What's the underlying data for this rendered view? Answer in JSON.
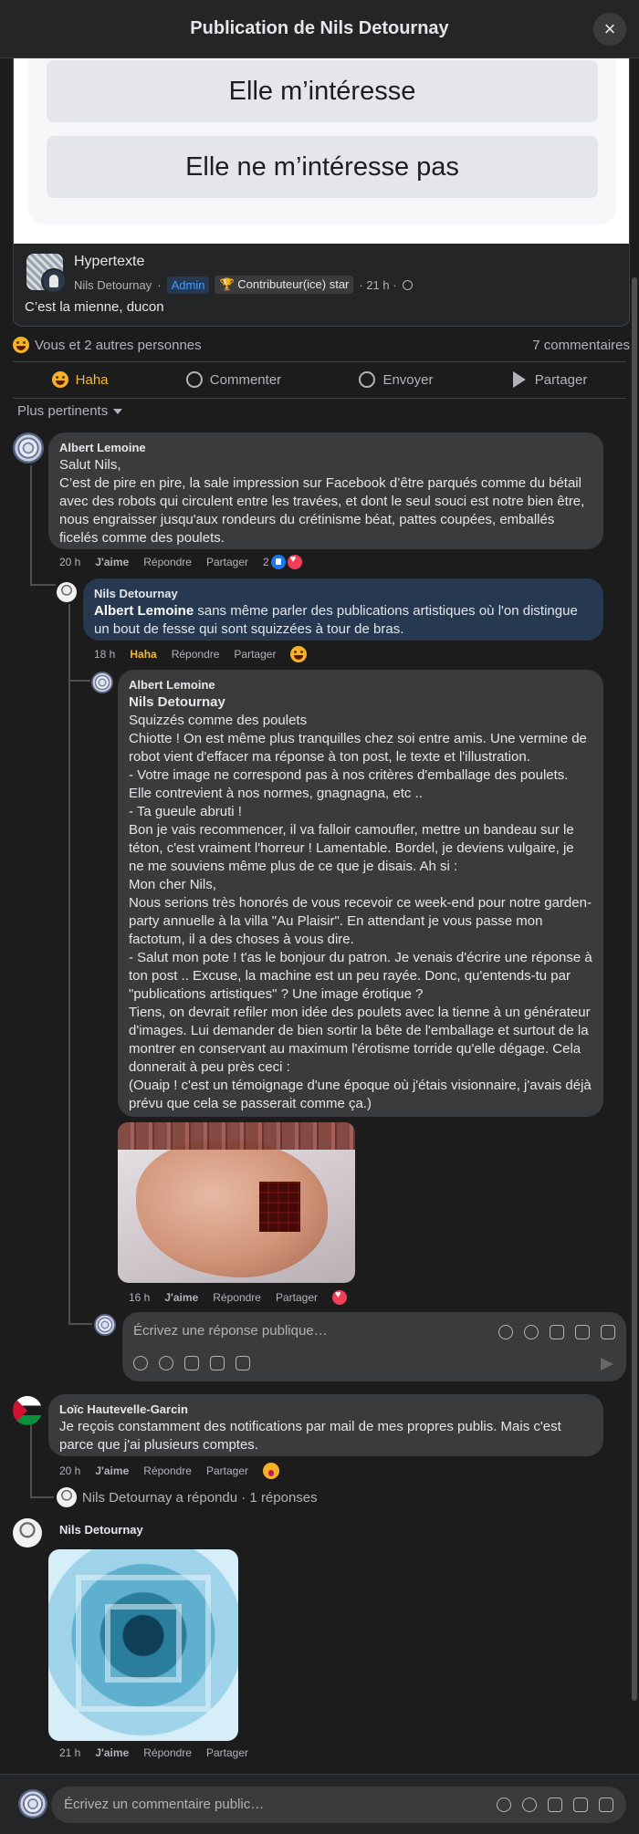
{
  "header": {
    "title": "Publication de Nils Detournay",
    "close_label": "×"
  },
  "shared_post": {
    "poll": {
      "option1": "Elle m’intéresse",
      "option2": "Elle ne m’intéresse pas"
    },
    "group_name": "Hypertexte",
    "author": "Nils Detournay",
    "sep1": "·",
    "badge_admin": "Admin",
    "badge_contrib": "Contributeur(ice) star",
    "time": "· 21 h ·",
    "text": "C’est la mienne, ducon"
  },
  "summary": {
    "reactions": "Vous et 2 autres personnes",
    "comments": "7 commentaires"
  },
  "actions": {
    "haha": "Haha",
    "comment": "Commenter",
    "send": "Envoyer",
    "share": "Partager"
  },
  "sort": {
    "label": "Plus pertinents"
  },
  "comments": [
    {
      "author": "Albert Lemoine",
      "text": "Salut Nils,\nC’est de pire en pire, la sale impression sur Facebook d’être parqués comme du bétail avec des robots qui circulent entre les travées, et dont le seul souci est notre bien être, nous engraisser jusqu'aux rondeurs du crétinisme béat, pattes coupées, emballés ficelés comme des poulets.",
      "time": "20 h",
      "like": "J'aime",
      "reply": "Répondre",
      "share": "Partager",
      "reaction_count": "2"
    },
    {
      "author": "Nils Detournay",
      "tag": "Albert Lemoine",
      "text": " sans même parler des publications artistiques où l'on distingue un bout de fesse qui sont squizzées à tour de bras.",
      "time": "18 h",
      "like": "Haha",
      "reply": "Répondre",
      "share": "Partager"
    },
    {
      "author": "Albert Lemoine",
      "tag": "Nils Detournay",
      "text": "Squizzés comme des poulets\nChiotte ! On est même plus tranquilles chez soi entre amis. Une vermine de robot vient d'effacer ma réponse à ton post, le texte et l'illustration.\n- Votre image ne correspond pas à nos critères d'emballage des poulets. Elle contrevient à nos normes, gnagnagna, etc ..\n- Ta gueule abruti !\nBon je vais recommencer, il va falloir camoufler, mettre un bandeau sur le téton, c'est vraiment l'horreur ! Lamentable. Bordel, je deviens vulgaire, je ne me souviens même plus de ce que je disais. Ah si :\nMon cher Nils,\nNous serions très honorés de vous recevoir ce week-end pour notre garden-party annuelle à la villa \"Au Plaisir\". En attendant je vous passe mon factotum, il a des choses à vous dire.\n- Salut mon pote ! t'as le bonjour du patron. Je venais d'écrire une réponse à ton post .. Excuse, la machine est un peu rayée. Donc, qu'entends-tu par \"publications artistiques\" ? Une image érotique ?\nTiens, on devrait refiler mon idée des poulets avec la tienne à un générateur d'images. Lui demander de bien sortir la bête de l'emballage et surtout de la montrer en conservant au maximum l'érotisme torride qu'elle dégage. Cela donnerait à peu près ceci :\n(Ouaip ! c'est un témoignage d'une époque où j'étais visionnaire, j'avais déjà prévu que cela se passerait comme ça.)",
      "time": "16 h",
      "like": "J'aime",
      "reply": "Répondre",
      "share": "Partager"
    },
    {
      "author": "Loïc Hautevelle-Garcin",
      "text": "Je reçois constamment des notifications par mail de mes propres publis. Mais c'est parce que j'ai plusieurs comptes.",
      "time": "20 h",
      "like": "J'aime",
      "reply": "Répondre",
      "share": "Partager"
    },
    {
      "author": "Nils Detournay",
      "time": "21 h",
      "like": "J'aime",
      "reply": "Répondre",
      "share": "Partager"
    }
  ],
  "reply_box": {
    "placeholder": "Écrivez une réponse publique…"
  },
  "replied_line": "Nils Detournay a répondu · 1 réponses",
  "footer": {
    "placeholder": "Écrivez un commentaire public…"
  },
  "colors": {
    "background": "#1c1c1d",
    "bubble": "#3a3b3c",
    "blue_bubble": "#263951",
    "haha": "#f7b928",
    "admin": "#4599ff"
  }
}
